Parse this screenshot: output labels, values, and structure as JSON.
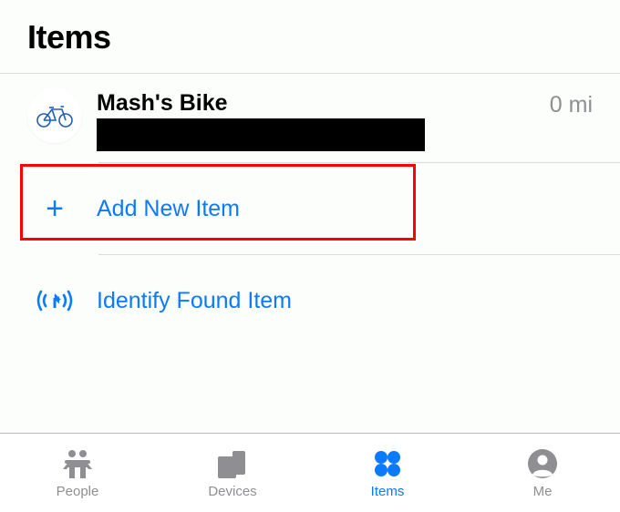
{
  "header": {
    "title": "Items"
  },
  "item": {
    "title": "Mash's Bike",
    "distance": "0 mi",
    "icon": "bicycle-icon"
  },
  "actions": {
    "add": {
      "label": "Add New Item",
      "icon": "plus-icon"
    },
    "identify": {
      "label": "Identify Found Item",
      "icon": "radar-icon"
    }
  },
  "tabs": {
    "people": "People",
    "devices": "Devices",
    "items": "Items",
    "me": "Me"
  },
  "colors": {
    "accent": "#0a7aff",
    "inactive": "#8e8e93"
  }
}
